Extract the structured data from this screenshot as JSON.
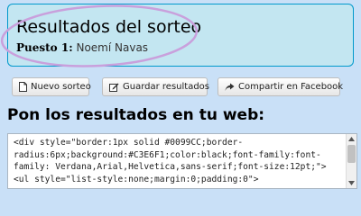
{
  "result": {
    "title": "Resultados del sorteo",
    "winner_label": "Puesto 1:",
    "winner_name": "Noemí Navas"
  },
  "toolbar": {
    "new_draw_label": "Nuevo sorteo",
    "save_label": "Guardar resultados",
    "share_label": "Compartir en Facebook"
  },
  "embed": {
    "heading": "Pon los resultados en tu web:",
    "code": "<div style=\"border:1px solid #0099CC;border-\nradius:6px;background:#C3E6F1;color:black;font-family:font-\nfamily: Verdana,Arial,Helvetica,sans-serif;font-size:12pt;\">\n<ul style=\"list-style:none;margin:0;padding:0\">"
  },
  "colors": {
    "page_background": "#c9e0f7",
    "result_box_background": "#c3e6f1",
    "result_box_border": "#0099cc",
    "highlight_circle": "#c9a0dc"
  }
}
